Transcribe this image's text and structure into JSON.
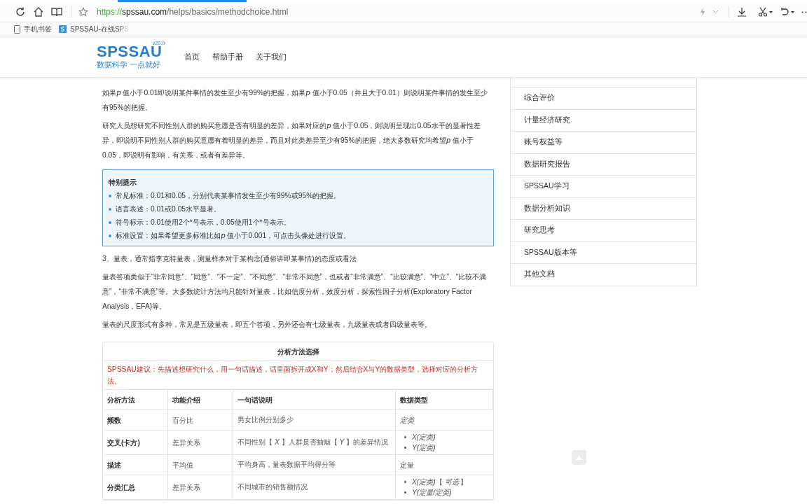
{
  "browser": {
    "address": {
      "scheme": "https://",
      "host": "spssau.com",
      "path": "/helps/basics/methodchoice.html"
    },
    "bookmarks": [
      {
        "kind": "phone",
        "label": "手机书签"
      },
      {
        "kind": "site",
        "label": "SPSSAU-在线SPS",
        "faded": true
      }
    ]
  },
  "site": {
    "logo": {
      "name": "SPSSAU",
      "version": "v20.0",
      "slogan": "数据科学 一点就好"
    },
    "nav": [
      "首页",
      "帮助手册",
      "关于我们"
    ]
  },
  "article": {
    "paragraphs_top": [
      [
        {
          "text": "如果"
        },
        {
          "text": "p",
          "kind": "variable"
        },
        {
          "text": " 值小于0.01即说明某件事情的发生至少有99%的把握，如果"
        },
        {
          "text": "p",
          "kind": "variable"
        },
        {
          "text": " 值小于0.05（并且大于0.01）则说明某件事情的发生至少有95%的把握。"
        }
      ],
      [
        {
          "text": "研究人员想研究不同性别人群的购买意愿是否有明显的差异，如果对应的"
        },
        {
          "text": "p",
          "kind": "variable"
        },
        {
          "text": " 值小于0.05，则说明呈现出0.05水平的显著性差异，即说明不同性别人群的购买意愿有着明显的差异，而且对此类差异至少有95%的把握，绝大多数研究均希望"
        },
        {
          "text": "p",
          "kind": "variable"
        },
        {
          "text": " 值小于0.05，即说明有影响，有关系，或者有差异等。"
        }
      ]
    ],
    "tip": {
      "title": "特别提示",
      "items": [
        [
          {
            "text": "常见标准：0.01和0.05，分别代表某事情发生至少有99%或95%的把握。"
          }
        ],
        [
          {
            "text": "语言表述：0.01或0.05水平显著。"
          }
        ],
        [
          {
            "text": "符号标示：0.01使用2个*号表示，0.05使用1个*号表示。"
          }
        ],
        [
          {
            "text": "标准设置：如果希望更多标准比如"
          },
          {
            "text": "p",
            "kind": "variable"
          },
          {
            "text": " 值小于0.001，可点击头像处进行设置。"
          }
        ]
      ]
    },
    "paragraphs_bottom": [
      "3、量表，通常指李克特量表，测量样本对于某构念(通俗讲即某事情)的态度或看法",
      "量表答项类似于“非常同意”、“同意”、“不一定”、“不同意”、“非常不同意”，也或者“非常满意”、“比较满意”、“中立”、“比较不满意”，“非常不满意”等。大多数统计方法均只能针对量表，比如信度分析，效度分析，探索性因子分析(Exploratory Factor Analysis，EFA)等。",
      "量表的尺度形式有多种，常见是五级量表，即五个答项，另外还会有七级量表，九级量表或者四级量表等。"
    ],
    "table": {
      "title": "分析方法选择",
      "note": "SPSSAU建议：先描述想研究什么，用一句话描述，话里面拆开成X和Y；然后结合X与Y的数据类型，选择对应的分析方法。",
      "columns": [
        "分析方法",
        "功能介绍",
        "一句话说明",
        "数据类型"
      ],
      "rows": [
        {
          "method": "频数",
          "function": "百分比",
          "sentence": "男女比例分别多少",
          "data_type": {
            "kind": "text",
            "items": [
              {
                "text": "定类",
                "italic": true
              }
            ]
          }
        },
        {
          "method": "交叉(卡方)",
          "function": "差异关系",
          "sentence": "不同性别【 *X* 】人群是否抽烟【 *Y* 】的差异情况",
          "data_type": {
            "kind": "list",
            "items": [
              {
                "text": "X(定类)",
                "italic": true
              },
              {
                "text": "Y(定类)",
                "italic": true
              }
            ]
          }
        },
        {
          "method": "描述",
          "function": "平均值",
          "sentence": "平均身高，量表数据平均得分等",
          "data_type": {
            "kind": "text",
            "items": [
              {
                "text": "定量",
                "italic": false
              }
            ]
          }
        },
        {
          "method": "分类汇总",
          "function": "差异关系",
          "sentence": "不同城市的销售额情况",
          "data_type": {
            "kind": "list",
            "items": [
              {
                "text": "*X(定类)*【 *可选* 】",
                "italic": false
              },
              {
                "text": "Y(定量/定类)",
                "italic": true
              }
            ]
          }
        }
      ]
    }
  },
  "sidebar": {
    "items": [
      "综合评价",
      "计量经济研究",
      "账号权益等",
      "数据研究报告",
      "SPSSAU学习",
      "数据分析知识",
      "研究思考",
      "SPSSAU版本等",
      "其他文档"
    ]
  }
}
